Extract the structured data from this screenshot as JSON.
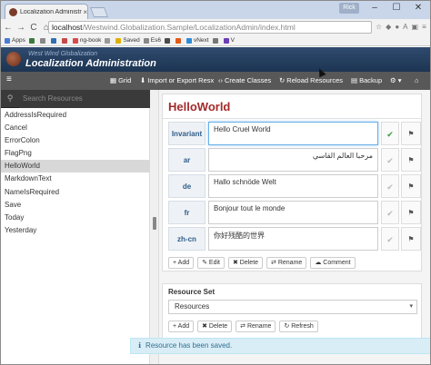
{
  "browser": {
    "tab_title": "Localization Administratio",
    "tab_close": "×",
    "user_badge": "Rick",
    "window_controls": [
      "–",
      "☐",
      "✕"
    ],
    "nav": {
      "back": "←",
      "forward": "→",
      "reload": "C",
      "home": "⌂"
    },
    "address_host": "localhost",
    "address_path": "/Westwind.Globalization.Sample/LocalizationAdmin/index.html",
    "bookmarks": [
      {
        "label": "Apps",
        "color": "#4a7bd6"
      },
      {
        "label": "",
        "color": "#3c7a3c"
      },
      {
        "label": "",
        "color": "#888888"
      },
      {
        "label": "",
        "color": "#2f6fb5"
      },
      {
        "label": "",
        "color": "#c44a4a"
      },
      {
        "label": "ng-book",
        "color": "#d84a4a"
      },
      {
        "label": "",
        "color": "#999999"
      },
      {
        "label": "Saved",
        "color": "#e0b000"
      },
      {
        "label": "Es6",
        "color": "#888888"
      },
      {
        "label": "",
        "color": "#4a4a4a"
      },
      {
        "label": "",
        "color": "#e05a1a"
      },
      {
        "label": "vNext",
        "color": "#2f8ad6"
      },
      {
        "label": "",
        "color": "#777777"
      },
      {
        "label": "V",
        "color": "#6a3fb5"
      }
    ]
  },
  "app": {
    "brand_sub": "West Wind Globalization",
    "brand_main": "Localization Administration"
  },
  "toolbar": {
    "menu_icon": "≡",
    "grid": "Grid",
    "import_export": "Import or Export Resx",
    "create_classes": "Create Classes",
    "reload_resources": "Reload Resources",
    "backup": "Backup",
    "settings_icon": "⚙ ▾",
    "home_icon": "⌂"
  },
  "sidebar": {
    "search_placeholder": "Search Resources",
    "items": [
      "AddressIsRequired",
      "Cancel",
      "ErrorColon",
      "FlagPng",
      "HelloWorld",
      "MarkdownText",
      "NameIsRequired",
      "Save",
      "Today",
      "Yesterday"
    ],
    "selected_index": 4
  },
  "resource": {
    "title": "HelloWorld",
    "rows": [
      {
        "lang": "Invariant",
        "value": "Hello Cruel World",
        "check_color": "#3c9a3c"
      },
      {
        "lang": "ar",
        "value": "مرحبا العالم القاسي",
        "check_color": "#bbbbbb"
      },
      {
        "lang": "de",
        "value": "Hallo schnöde Welt",
        "check_color": "#bbbbbb"
      },
      {
        "lang": "fr",
        "value": "Bonjour tout le monde",
        "check_color": "#bbbbbb"
      },
      {
        "lang": "zh-cn",
        "value": "你好残酷的世界",
        "check_color": "#bbbbbb"
      }
    ],
    "check_icon": "✔",
    "comment_icon": "⚑",
    "actions": {
      "add": "+ Add",
      "edit": "✎ Edit",
      "delete": "✖ Delete",
      "rename": "⇄ Rename",
      "comment": "☁ Comment"
    }
  },
  "resource_set": {
    "label": "Resource Set",
    "selected": "Resources",
    "caret": "▾",
    "actions": {
      "add": "+ Add",
      "delete": "✖ Delete",
      "rename": "⇄ Rename",
      "refresh": "↻ Refresh"
    }
  },
  "toast": {
    "icon": "ℹ",
    "message": "Resource has been saved."
  }
}
